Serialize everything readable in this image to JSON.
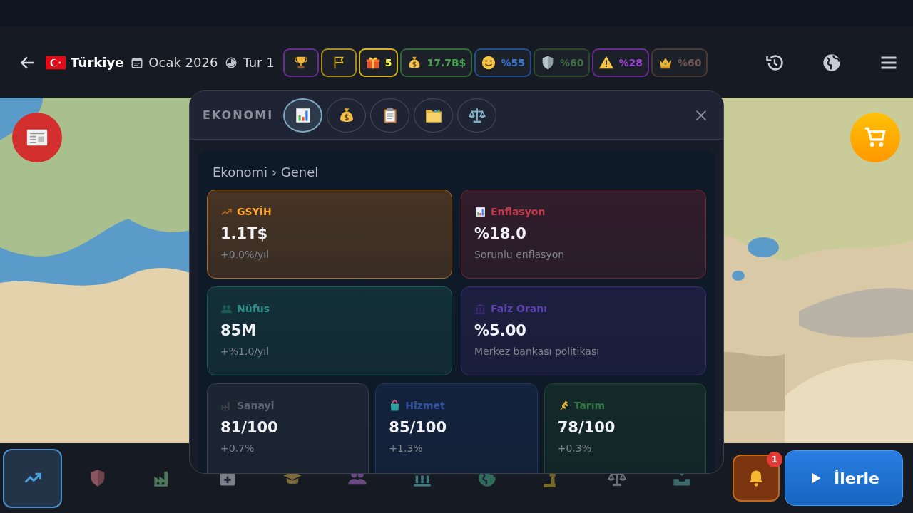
{
  "top_bar": {
    "country": "Türkiye",
    "date": "Ocak 2026",
    "turn": "Tur 1",
    "badges": [
      {
        "kind": "trophy",
        "color": "#6a2c91"
      },
      {
        "kind": "flag",
        "color": "#a88a1c"
      },
      {
        "kind": "gift",
        "value": "5",
        "color": "#d4b21f"
      },
      {
        "kind": "money",
        "value": "17.7B$",
        "color": "#2e6b34"
      },
      {
        "kind": "smile",
        "value": "%55",
        "color": "#1f4f8f"
      },
      {
        "kind": "shield",
        "value": "%60",
        "color": "#2a4a2c"
      },
      {
        "kind": "warning",
        "value": "%28",
        "color": "#6a2c91"
      },
      {
        "kind": "crown",
        "value": "%60",
        "color": "#4a3a34"
      }
    ]
  },
  "modal": {
    "title": "EKONOMI",
    "tabs": [
      {
        "kind": "chart",
        "selected": true
      },
      {
        "kind": "moneybag",
        "selected": false
      },
      {
        "kind": "clipboard",
        "selected": false
      },
      {
        "kind": "folder",
        "selected": false
      },
      {
        "kind": "scales",
        "selected": false
      }
    ],
    "breadcrumb": "Ekonomi › Genel",
    "cards": [
      {
        "kind": "trend",
        "title": "GSYİH",
        "value": "1.1T$",
        "note": "+0.0%/yıl",
        "color": "#b8671c"
      },
      {
        "kind": "bars",
        "title": "Enflasyon",
        "value": "%18.0",
        "note": "Sorunlu enflasyon",
        "color": "#7a2430"
      },
      {
        "kind": "people",
        "title": "Nüfus",
        "value": "85M",
        "note": "+%1.0/yıl",
        "color": "#1c5a55"
      },
      {
        "kind": "bank",
        "title": "Faiz Oranı",
        "value": "%5.00",
        "note": "Merkez bankası politikası",
        "color": "#3a2a6e"
      },
      {
        "kind": "factory",
        "title": "Sanayi",
        "value": "81/100",
        "note": "+0.7%",
        "color": "#3a3f48"
      },
      {
        "kind": "bag",
        "title": "Hizmet",
        "value": "85/100",
        "note": "+1.3%",
        "color": "#1f3466"
      },
      {
        "kind": "wheat",
        "title": "Tarım",
        "value": "78/100",
        "note": "+0.3%",
        "color": "#1f4a2a"
      }
    ]
  },
  "bottom_nav": {
    "items": [
      {
        "kind": "trend",
        "selected": true,
        "color": "#4aa3e0"
      },
      {
        "kind": "shield",
        "selected": false,
        "color": "#8a5560"
      },
      {
        "kind": "factory",
        "selected": false,
        "color": "#4f7a5a"
      },
      {
        "kind": "medical",
        "selected": false,
        "color": "#7a7f88"
      },
      {
        "kind": "cap",
        "selected": false,
        "color": "#7a6a3a"
      },
      {
        "kind": "people",
        "selected": false,
        "color": "#6a4a80"
      },
      {
        "kind": "bank",
        "selected": false,
        "color": "#3f7a80"
      },
      {
        "kind": "globe",
        "selected": false,
        "color": "#2f6a5a"
      },
      {
        "kind": "gavel",
        "selected": false,
        "color": "#7a6a2a"
      },
      {
        "kind": "scales",
        "selected": false,
        "color": "#6a6f78"
      },
      {
        "kind": "inbox",
        "selected": false,
        "color": "#3f6a6a"
      }
    ],
    "notifications": {
      "count": "1"
    },
    "advance": {
      "label": "İlerle"
    }
  }
}
